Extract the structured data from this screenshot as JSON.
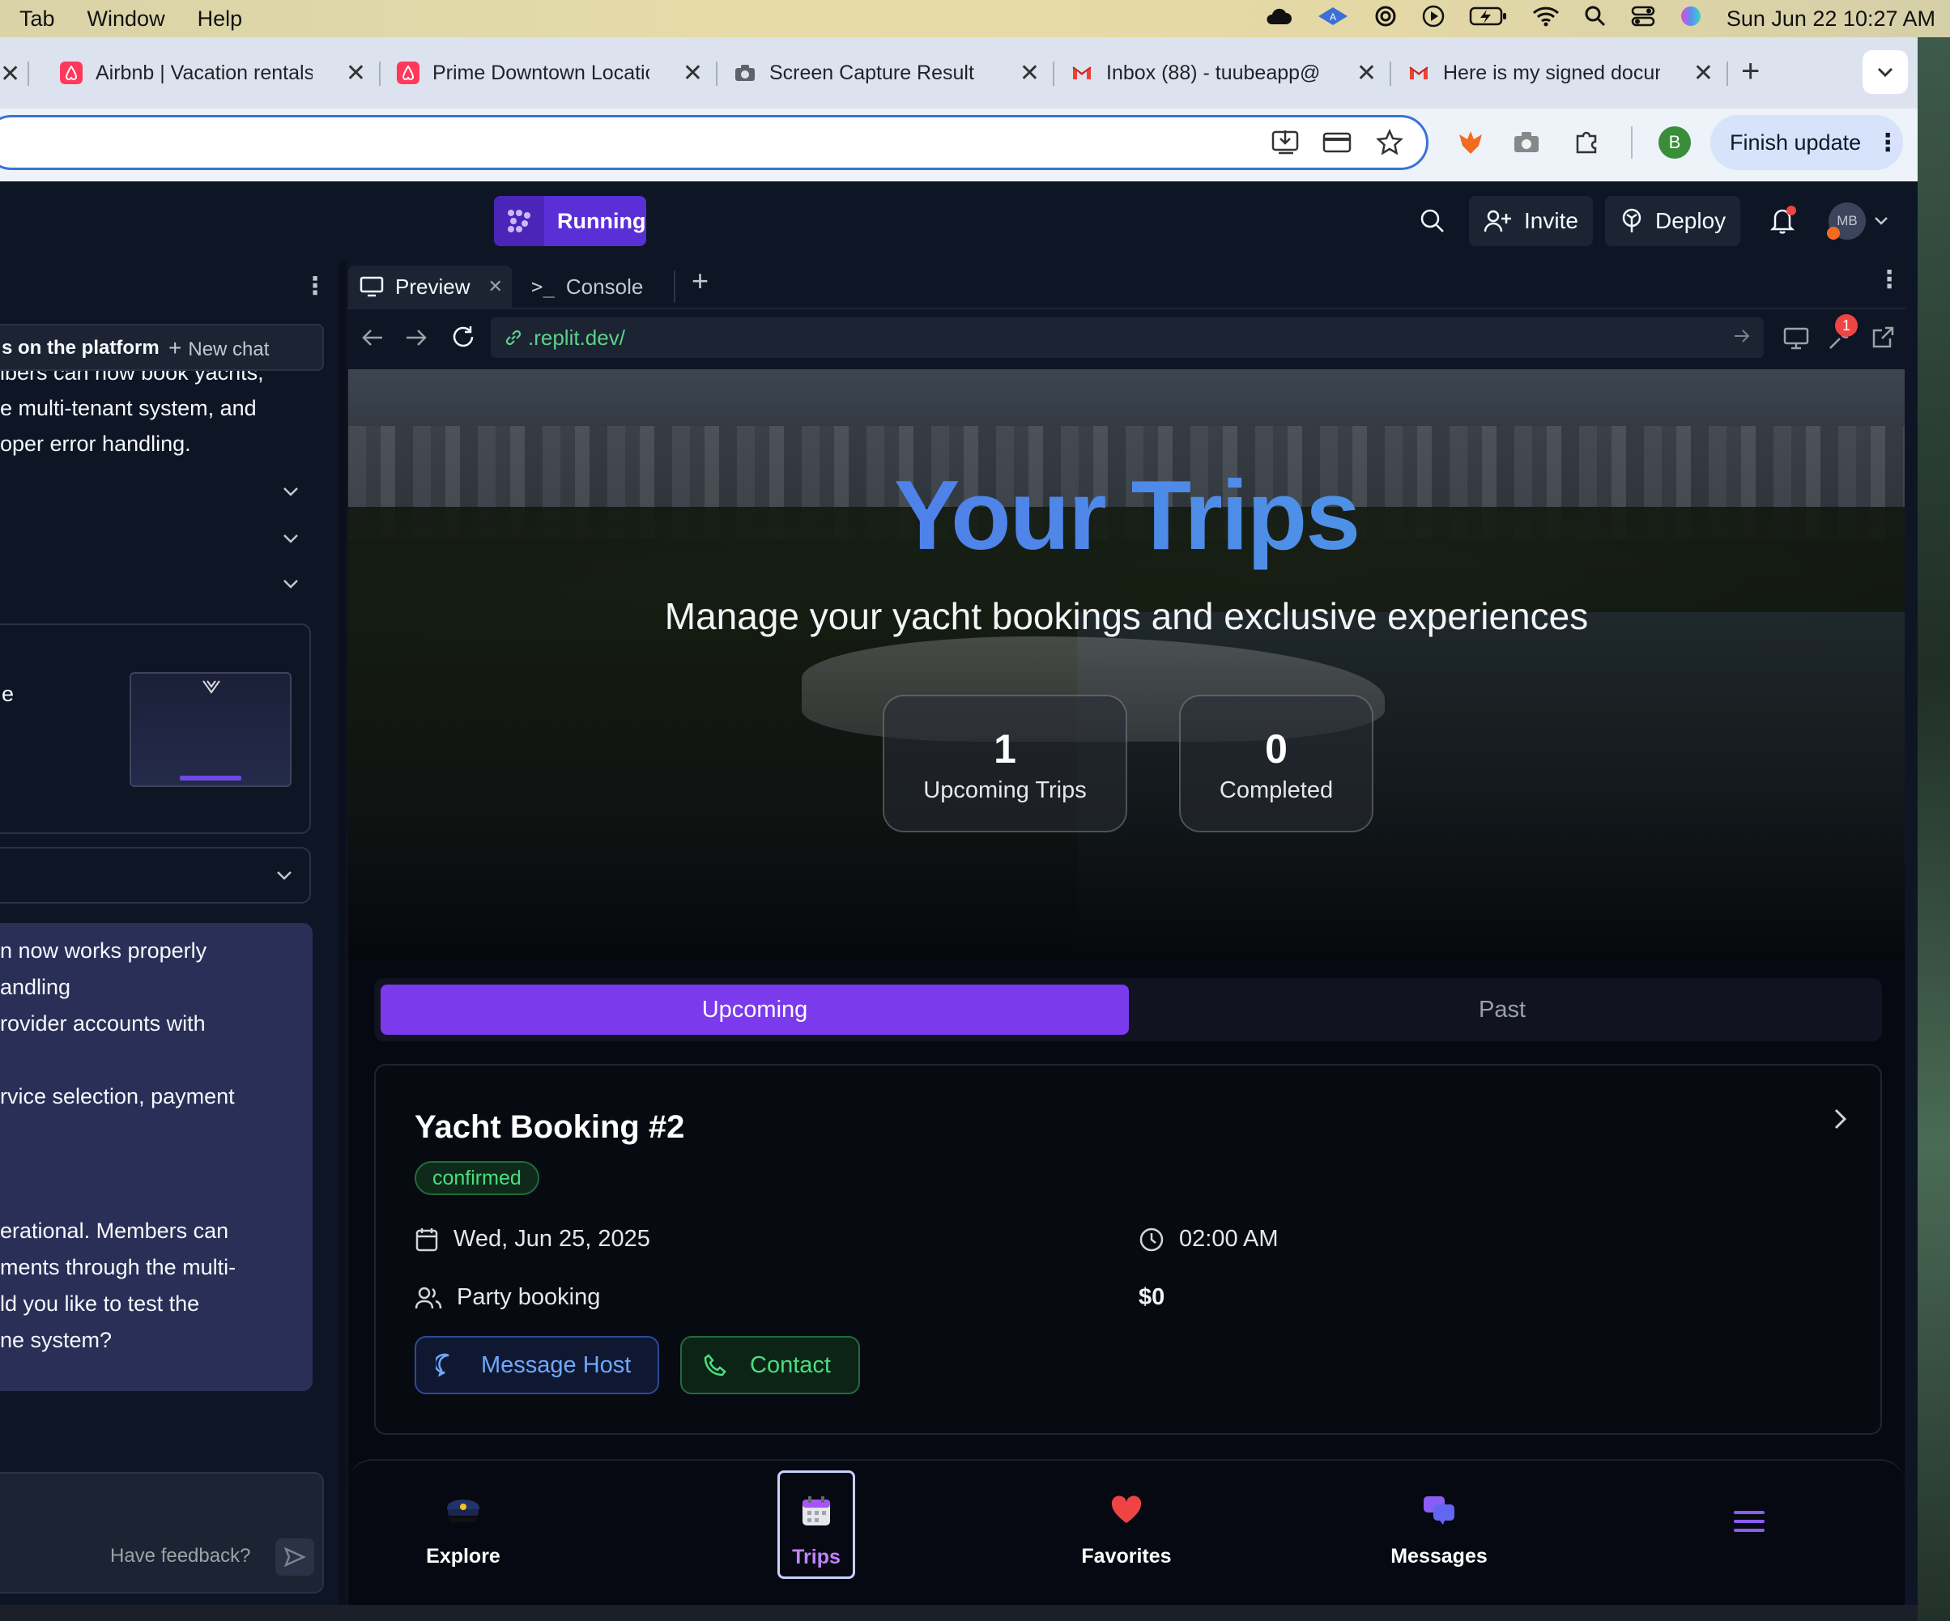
{
  "menubar": {
    "items": [
      "Tab",
      "Window",
      "Help"
    ],
    "clock": "Sun Jun 22  10:27 AM"
  },
  "browser": {
    "tabs": [
      {
        "label": "Airbnb | Vacation rentals",
        "icon": "airbnb-icon"
      },
      {
        "label": "Prime Downtown Location",
        "icon": "airbnb-icon"
      },
      {
        "label": "Screen Capture Result",
        "icon": "camera-icon"
      },
      {
        "label": "Inbox (88) - tuubeapp@",
        "icon": "gmail-icon"
      },
      {
        "label": "Here is my signed document",
        "icon": "gmail-icon"
      }
    ],
    "profile_initial": "B",
    "finish_update": "Finish update"
  },
  "replit": {
    "status": "Running",
    "invite": "Invite",
    "deploy": "Deploy",
    "avatar": "MB"
  },
  "chat": {
    "title": "s on the platform",
    "new_chat": "New chat",
    "msg1": [
      "ibers can now book yachts,",
      "e multi-tenant system, and",
      "oper error handling."
    ],
    "thumb_label": "e",
    "msg2": [
      "n now works properly",
      "andling",
      "rovider accounts with",
      "",
      "rvice selection, payment"
    ],
    "msg3": [
      "erational. Members can",
      "ments through the multi-",
      "ld you like to test the",
      "ne system?"
    ],
    "feedback": "Have feedback?"
  },
  "workspace": {
    "tab_preview": "Preview",
    "tab_console": "Console",
    "url": ".replit.dev/",
    "notif_count": "1"
  },
  "app": {
    "hero_title": "Your Trips",
    "hero_subtitle": "Manage your yacht bookings and exclusive experiences",
    "stats": [
      {
        "value": "1",
        "label": "Upcoming Trips"
      },
      {
        "value": "0",
        "label": "Completed"
      }
    ],
    "segments": {
      "upcoming": "Upcoming",
      "past": "Past"
    },
    "booking": {
      "title": "Yacht Booking #2",
      "status": "confirmed",
      "date": "Wed, Jun 25, 2025",
      "time": "02:00 AM",
      "party": "Party booking",
      "price": "$0",
      "message_host": "Message Host",
      "contact": "Contact"
    },
    "nav": [
      {
        "label": "Explore",
        "icon": "captain-hat-icon"
      },
      {
        "label": "Trips",
        "icon": "calendar-icon"
      },
      {
        "label": "Favorites",
        "icon": "heart-icon"
      },
      {
        "label": "Messages",
        "icon": "chat-bubbles-icon"
      },
      {
        "label": "",
        "icon": "menu-icon"
      }
    ]
  },
  "colors": {
    "accent": "#7c3aed",
    "replit_bg": "#0e1525",
    "confirmed": "#4ade80"
  }
}
